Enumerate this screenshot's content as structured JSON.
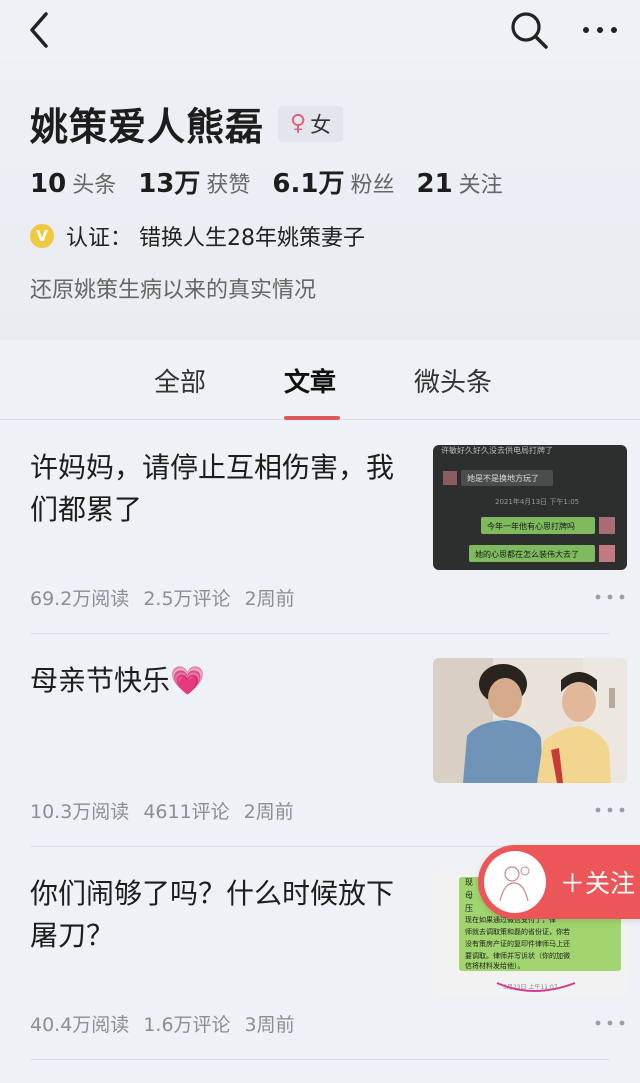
{
  "profile": {
    "name": "姚策爱人熊磊",
    "gender": "女",
    "gender_symbol": "♀",
    "stats": [
      {
        "num": "10",
        "label": "头条"
      },
      {
        "num": "13万",
        "label": "获赞"
      },
      {
        "num": "6.1万",
        "label": "粉丝"
      },
      {
        "num": "21",
        "label": "关注"
      }
    ],
    "verify_badge": "V",
    "verify_text": "认证： 错换人生28年姚策妻子",
    "bio": "还原姚策生病以来的真实情况"
  },
  "tabs": [
    {
      "label": "全部",
      "active": false
    },
    {
      "label": "文章",
      "active": true
    },
    {
      "label": "微头条",
      "active": false
    }
  ],
  "articles": [
    {
      "title": "许妈妈，请停止互相伤害，我们都累了",
      "reads": "69.2万阅读",
      "comments": "2.5万评论",
      "time": "2周前",
      "thumb": {
        "top_text": "许敏好久好久没去供电局打牌了",
        "row1": "她是不是换地方玩了",
        "time": "2021年4月13日 下午1:05",
        "row2": "今年一年他有心思打牌吗",
        "row3": "她的心思都在怎么装伟大去了"
      }
    },
    {
      "title": "母亲节快乐",
      "reads": "10.3万阅读",
      "comments": "4611评论",
      "time": "2周前",
      "emoji": "💗"
    },
    {
      "title": "你们闹够了吗？什么时候放下屠刀？",
      "reads": "40.4万阅读",
      "comments": "1.6万评论",
      "time": "3周前",
      "thumb": {
        "col": [
          "现",
          "母",
          "压"
        ],
        "l1": "现在如果通过微信支付了，律",
        "l2": "师就去调取策和磊的省份证，你若",
        "l3": "没有策房产证的复印件律师马上还",
        "l4": "要调取。律师并写诉状（你的加微",
        "l5": "信将材料发给他）。",
        "time": "3月23日 上午11:07"
      }
    }
  ],
  "follow_fab_label": "＋关注",
  "colors": {
    "accent": "#e0575b",
    "fab": "#ec5658",
    "background": "#eef1f6",
    "verify": "#f0c93c"
  }
}
